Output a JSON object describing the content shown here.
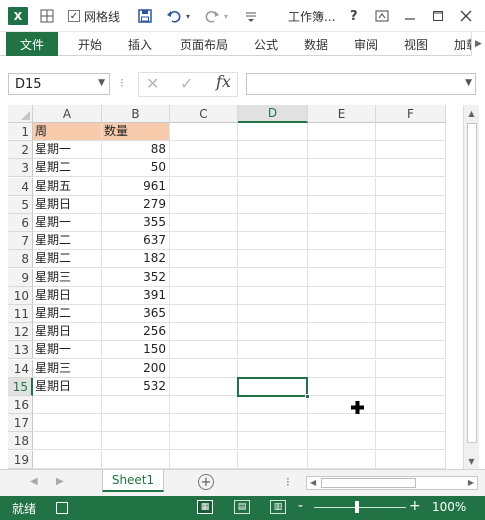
{
  "titlebar": {
    "app_logo": "X",
    "gridlines_label": "网格线",
    "gridlines_checked": "✓",
    "window_title": "工作簿...",
    "help": "?",
    "icons": [
      "excel-logo",
      "table-icon",
      "save-icon",
      "undo-icon",
      "redo-icon",
      "customize-icon",
      "help-icon",
      "ribbon-options-icon",
      "minimize-icon",
      "restore-icon",
      "close-icon"
    ]
  },
  "ribbon": {
    "tabs": [
      "文件",
      "开始",
      "插入",
      "页面布局",
      "公式",
      "数据",
      "审阅",
      "视图",
      "加载"
    ]
  },
  "formula_bar": {
    "name_box": "D15",
    "fx": "fx",
    "content": ""
  },
  "sheet": {
    "columns": [
      "A",
      "B",
      "C",
      "D",
      "E",
      "F"
    ],
    "rows": [
      "1",
      "2",
      "3",
      "4",
      "5",
      "6",
      "7",
      "8",
      "9",
      "10",
      "11",
      "12",
      "13",
      "14",
      "15",
      "16",
      "17",
      "18",
      "19"
    ],
    "active_cell": "D15",
    "header": {
      "a": "周",
      "b": "数量"
    },
    "header_fill": "#f8cbad",
    "data": [
      {
        "a": "星期一",
        "b": "88"
      },
      {
        "a": "星期二",
        "b": "50"
      },
      {
        "a": "星期五",
        "b": "961"
      },
      {
        "a": "星期日",
        "b": "279"
      },
      {
        "a": "星期一",
        "b": "355"
      },
      {
        "a": "星期二",
        "b": "637"
      },
      {
        "a": "星期二",
        "b": "182"
      },
      {
        "a": "星期三",
        "b": "352"
      },
      {
        "a": "星期日",
        "b": "391"
      },
      {
        "a": "星期二",
        "b": "365"
      },
      {
        "a": "星期日",
        "b": "256"
      },
      {
        "a": "星期一",
        "b": "150"
      },
      {
        "a": "星期三",
        "b": "200"
      },
      {
        "a": "星期日",
        "b": "532"
      }
    ]
  },
  "sheet_tabs": {
    "tabs": [
      "Sheet1"
    ]
  },
  "status": {
    "ready": "就绪",
    "zoom": "100%",
    "zoom_minus": "-",
    "zoom_plus": "+"
  },
  "colors": {
    "accent": "#217346",
    "header_fill": "#f8cbad"
  }
}
